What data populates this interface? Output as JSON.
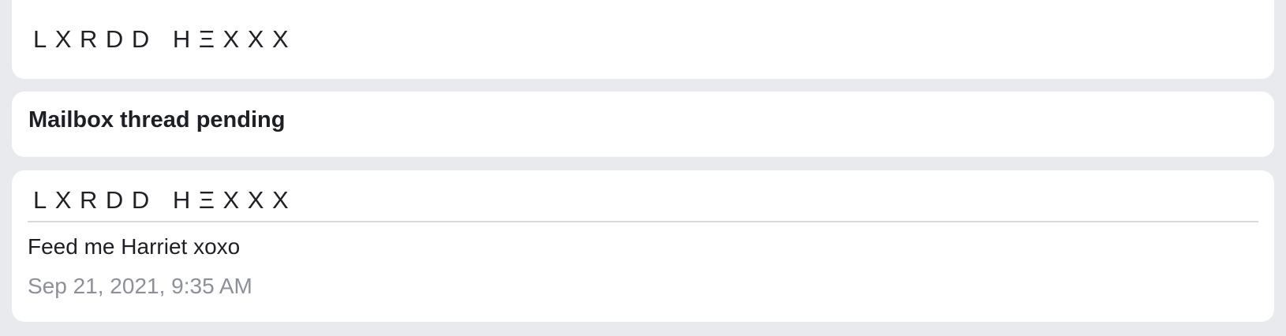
{
  "top_card": {
    "brand": "LXRDD HΞXXX"
  },
  "status_card": {
    "title": "Mailbox thread pending"
  },
  "message_card": {
    "sender": "LXRDD HΞXXX",
    "text": "Feed me Harriet xoxo",
    "timestamp": "Sep 21, 2021, 9:35 AM"
  },
  "colors": {
    "background": "#e9eaee",
    "card": "#ffffff",
    "text": "#1d1f24",
    "muted": "#8d9099",
    "divider": "#d9d9dc"
  }
}
